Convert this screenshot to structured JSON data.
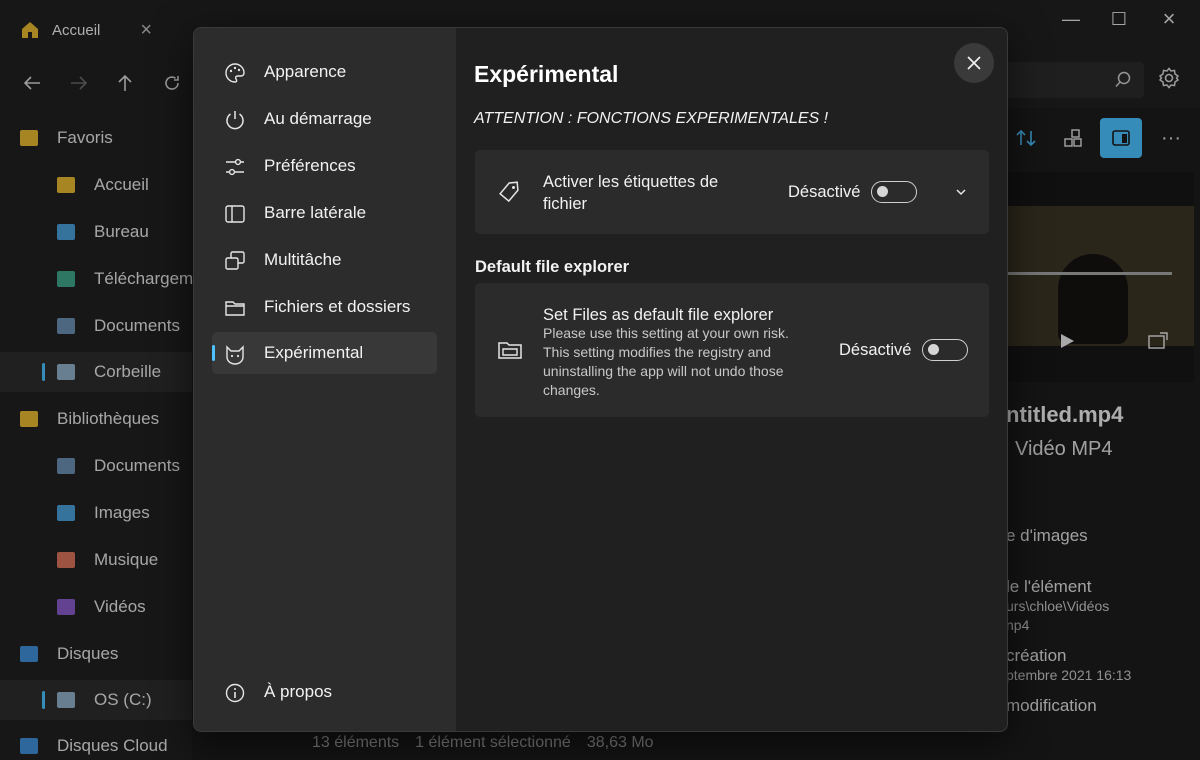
{
  "app": {
    "tabs": [
      {
        "label": "Accueil"
      }
    ],
    "nav": {
      "back": "←",
      "forward": "→",
      "up": "↑",
      "refresh": "⟳"
    },
    "sidebar": {
      "items": [
        {
          "label": "Favoris",
          "icon": "star-icon",
          "color": "#e8b931"
        },
        {
          "label": "Accueil",
          "icon": "home-icon",
          "color": "#e8b931"
        },
        {
          "label": "Bureau",
          "icon": "desktop-folder-icon",
          "color": "#4a9fd8"
        },
        {
          "label": "Téléchargements",
          "icon": "download-folder-icon",
          "color": "#3fa58a"
        },
        {
          "label": "Documents",
          "icon": "documents-folder-icon",
          "color": "#6d8fb3"
        },
        {
          "label": "Corbeille",
          "icon": "recycle-bin-icon",
          "color": "#8fb0c9"
        },
        {
          "label": "Bibliothèques",
          "icon": "library-folder-icon",
          "color": "#e8b931"
        },
        {
          "label": "Documents",
          "icon": "documents-icon",
          "color": "#6d8fb3"
        },
        {
          "label": "Images",
          "icon": "images-icon",
          "color": "#4a9fd8"
        },
        {
          "label": "Musique",
          "icon": "music-icon",
          "color": "#d9735a"
        },
        {
          "label": "Vidéos",
          "icon": "videos-icon",
          "color": "#8a5cc9"
        },
        {
          "label": "Disques",
          "icon": "monitor-icon",
          "color": "#3f8fd8"
        },
        {
          "label": "OS (C:)",
          "icon": "drive-icon",
          "color": "#8fb0c9"
        },
        {
          "label": "Disques Cloud",
          "icon": "cloud-icon",
          "color": "#3f8fd8"
        }
      ]
    },
    "details": {
      "filename": "ntitled.mp4",
      "type": "Vidéo MP4",
      "rows": [
        "e d'images",
        "le l'élément",
        "urs\\chloe\\Vidéos",
        "np4",
        "création",
        "ptembre 2021 16:13",
        "modification"
      ]
    },
    "status": {
      "count": "13 éléments",
      "selection": "1 élément sélectionné",
      "size": "38,63 Mo"
    }
  },
  "settings": {
    "nav": [
      {
        "label": "Apparence",
        "icon": "palette-icon"
      },
      {
        "label": "Au démarrage",
        "icon": "power-icon"
      },
      {
        "label": "Préférences",
        "icon": "sliders-icon"
      },
      {
        "label": "Barre latérale",
        "icon": "sidebar-icon"
      },
      {
        "label": "Multitâche",
        "icon": "multitask-icon"
      },
      {
        "label": "Fichiers et dossiers",
        "icon": "folder-icon"
      },
      {
        "label": "Expérimental",
        "icon": "cat-icon"
      }
    ],
    "about": {
      "label": "À propos",
      "icon": "info-icon"
    },
    "active": "Expérimental",
    "page": {
      "title": "Expérimental",
      "warning": "ATTENTION : FONCTIONS EXPERIMENTALES !",
      "tags_card": {
        "title_line1": "Activer les étiquettes de",
        "title_line2": "fichier",
        "toggle_label": "Désactivé",
        "toggle_on": false
      },
      "section_default": "Default file explorer",
      "default_card": {
        "title": "Set Files as default file explorer",
        "desc_lines": [
          "Please use this setting at your own risk.",
          "This setting modifies the registry and",
          "uninstalling the app will not undo those",
          "changes."
        ],
        "toggle_label": "Désactivé",
        "toggle_on": false
      }
    }
  },
  "colors": {
    "accent": "#4cc2ff",
    "active_cmd": "#4cc2ff"
  }
}
